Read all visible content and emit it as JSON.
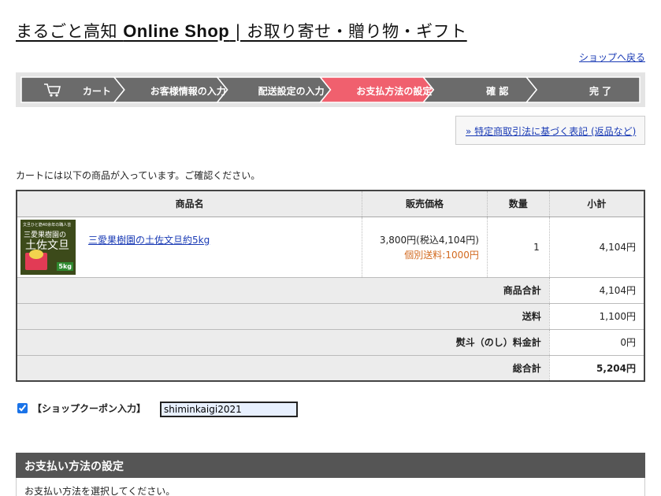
{
  "site": {
    "title_pre": "まるごと高知 ",
    "title_bold": "Online Shop",
    "title_post": " | お取り寄せ・贈り物・ギフト",
    "back_link": "ショップへ戻る"
  },
  "steps": [
    {
      "label": "カート",
      "active": false
    },
    {
      "label": "お客様情報の入力",
      "active": false
    },
    {
      "label": "配送設定の入力",
      "active": false
    },
    {
      "label": "お支払方法の設定",
      "active": true
    },
    {
      "label": "確 認",
      "active": false
    },
    {
      "label": "完 了",
      "active": false
    }
  ],
  "colors": {
    "step_bg": "#6b6b6b",
    "step_active": "#f0606e",
    "step_sep": "#ffffff",
    "link": "#1a3bb5",
    "shipping_note": "#d2691e"
  },
  "tokutei_link": "» 特定商取引法に基づく表記 (返品など)",
  "cart_message": "カートには以下の商品が入っています。ご確認ください。",
  "table": {
    "headers": [
      "商品名",
      "販売価格",
      "数量",
      "小計"
    ],
    "item": {
      "thumb_top": "文旦ひと筋40余年の職人芸",
      "thumb_brand": "三愛果樹園の",
      "thumb_name": "土佐文旦",
      "thumb_kg": "5kg",
      "name": "三愛果樹園の土佐文旦約5kg",
      "price": "3,800円(税込4,104円)",
      "shipping": "個別送料:1000円",
      "qty": "1",
      "subtotal": "4,104円"
    },
    "summary": [
      {
        "label": "商品合計",
        "value": "4,104円"
      },
      {
        "label": "送料",
        "value": "1,100円"
      },
      {
        "label": "熨斗（のし）料金計",
        "value": "0円"
      },
      {
        "label": "総合計",
        "value": "5,204円"
      }
    ]
  },
  "coupon": {
    "label": "【ショップクーポン入力】",
    "checked": true,
    "value": "shiminkaigi2021"
  },
  "payment": {
    "heading": "お支払い方法の設定",
    "instruction": "お支払い方法を選択してください。"
  }
}
